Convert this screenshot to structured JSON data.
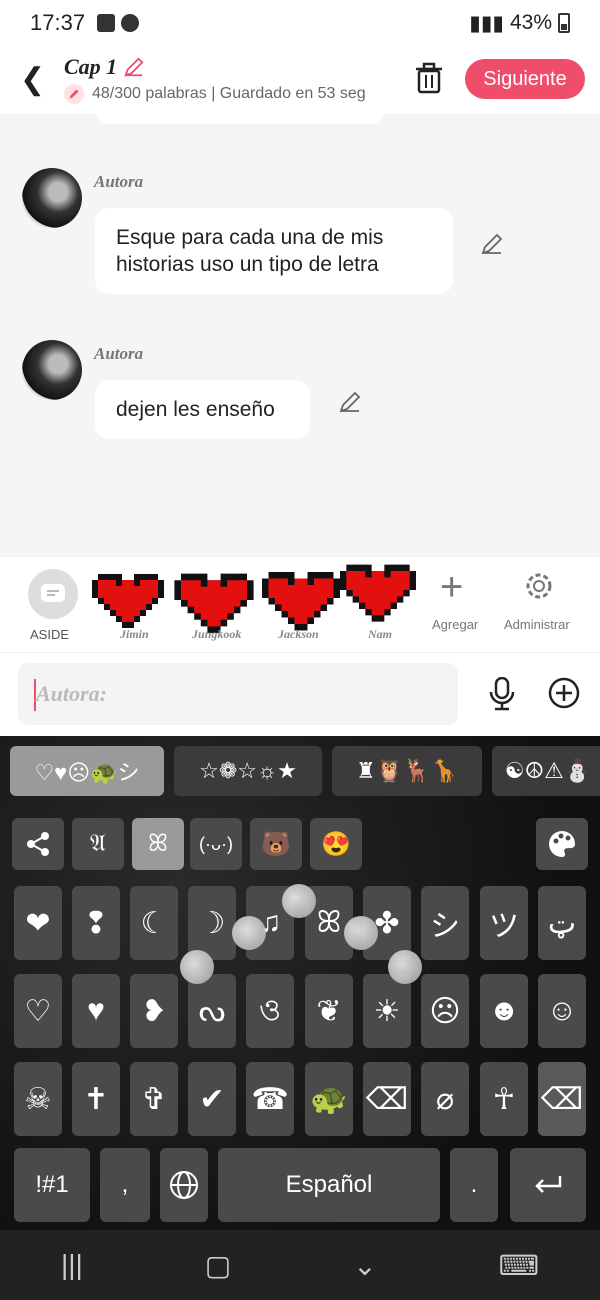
{
  "status": {
    "time": "17:37",
    "battery": "43%"
  },
  "header": {
    "title": "Cap 1",
    "subtitle": "48/300 palabras | Guardado en 53 seg",
    "next_label": "Siguiente"
  },
  "messages": [
    {
      "author": "Autora",
      "text_line1": "Esque para cada una de mis",
      "text_line2": "historias uso un tipo de letra"
    },
    {
      "author": "Autora",
      "text": "dejen les enseño"
    }
  ],
  "characters": {
    "aside_label": "ASIDE",
    "items": [
      {
        "name": "Jimin"
      },
      {
        "name": "Jungkook"
      },
      {
        "name": "Jackson"
      },
      {
        "name": "Nam"
      }
    ],
    "add_label": "Agregar",
    "manage_label": "Administrar"
  },
  "input": {
    "placeholder": "Autora:"
  },
  "keyboard": {
    "tabs": [
      "♡♥☹🐢シ",
      "☆❁☆☼★",
      "♜🦉🦌🦒",
      "☯☮⚠⛄"
    ],
    "categories": [
      "share",
      "𝔄",
      "ꕤ",
      "(·ᴗ·)",
      "🐻",
      "😍"
    ],
    "row1": [
      "❤",
      "❢",
      "☾",
      "☽",
      "♫",
      "ꕤ",
      "✤",
      "シ",
      "ツ",
      "ټ"
    ],
    "row2": [
      "♡",
      "♥",
      "❥",
      "ᔓ",
      "ও",
      "❦",
      "☀",
      "☹",
      "☻",
      "☺"
    ],
    "row3": [
      "☠",
      "✝",
      "✞",
      "✔",
      "☎",
      "🐢",
      "⌫",
      "⌀",
      "☥",
      "⌫"
    ],
    "bottom": {
      "sym": "!#1",
      "comma": ",",
      "space": "Español",
      "period": "."
    }
  }
}
